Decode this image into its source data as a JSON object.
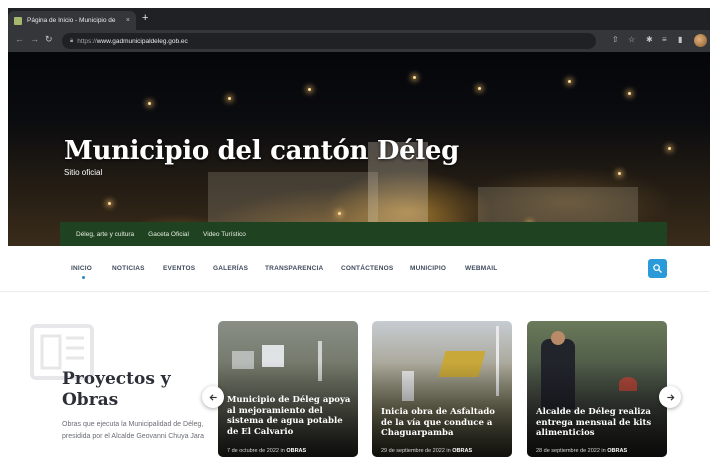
{
  "browser": {
    "tab_title": "Página de Inicio - Municipio de",
    "tab_close": "×",
    "new_tab": "+",
    "url_scheme": "https://",
    "url_host": "www.gadmunicipaldeleg.gob.ec"
  },
  "hero": {
    "title": "Municipio del cantón Déleg",
    "subtitle": "Sitio oficial"
  },
  "secondary_nav": {
    "items": [
      "Déleg, arte y cultura",
      "Gaceta Oficial",
      "Video Turístico"
    ]
  },
  "main_nav": {
    "items": [
      "INICIO",
      "NOTICIAS",
      "EVENTOS",
      "GALERÍAS",
      "TRANSPARENCIA",
      "CONTÁCTENOS",
      "MUNICIPIO",
      "WEBMAIL"
    ],
    "active": "INICIO"
  },
  "section": {
    "title": "Proyectos y Obras",
    "text": "Obras que ejecuta la Municipalidad de Déleg, presidida por el Alcalde Geovanni Chuya Jara"
  },
  "cards": [
    {
      "title": "Municipio de Déleg apoya al mejoramiento del sistema de agua potable de El Calvario",
      "date": "7 de octubre de 2022 in",
      "category": "OBRAS"
    },
    {
      "title": "Inicia obra de Asfaltado de la vía que conduce a Chaguarpamba",
      "date": "29 de septiembre de 2022 in",
      "category": "OBRAS"
    },
    {
      "title": "Alcalde de Déleg realiza entrega mensual de kits alimenticios",
      "date": "28 de septiembre de 2022 in",
      "category": "OBRAS"
    }
  ],
  "colors": {
    "green_bar": "#1f4320",
    "accent_blue": "#2a9bd8",
    "nav_text": "#3f4a5c"
  },
  "icons": {
    "back": "arrow-left-icon",
    "forward": "arrow-right-icon",
    "reload": "reload-icon",
    "search": "search-icon",
    "prev": "chevron-left-icon",
    "next": "chevron-right-icon"
  }
}
